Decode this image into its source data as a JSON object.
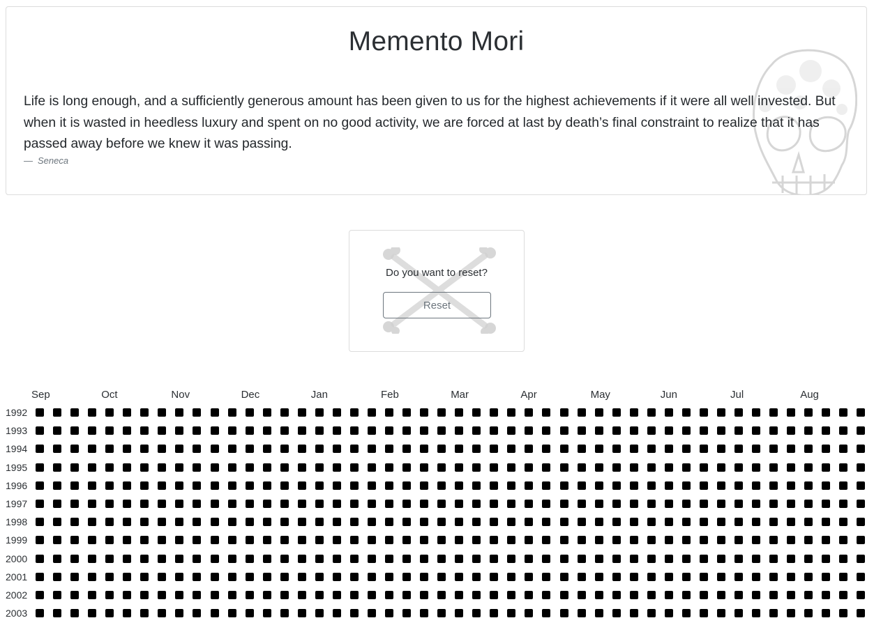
{
  "header": {
    "title": "Memento Mori",
    "quote": "Life is long enough, and a sufficiently generous amount has been given to us for the highest achievements if it were all well invested. But when it is wasted in heedless luxury and spent on no good activity, we are forced at last by death’s final constraint to realize that it has passed away before we knew it was passing.",
    "quote_dash": "—",
    "quote_author": "Seneca"
  },
  "reset": {
    "prompt": "Do you want to reset?",
    "button_label": "Reset"
  },
  "calendar": {
    "months": [
      "Sep",
      "Oct",
      "Nov",
      "Dec",
      "Jan",
      "Feb",
      "Mar",
      "Apr",
      "May",
      "Jun",
      "Jul",
      "Aug"
    ],
    "years": [
      "1992",
      "1993",
      "1994",
      "1995",
      "1996",
      "1997",
      "1998",
      "1999",
      "2000",
      "2001",
      "2002",
      "2003"
    ],
    "weeks_per_year": 48,
    "cell_color": "#000000"
  }
}
